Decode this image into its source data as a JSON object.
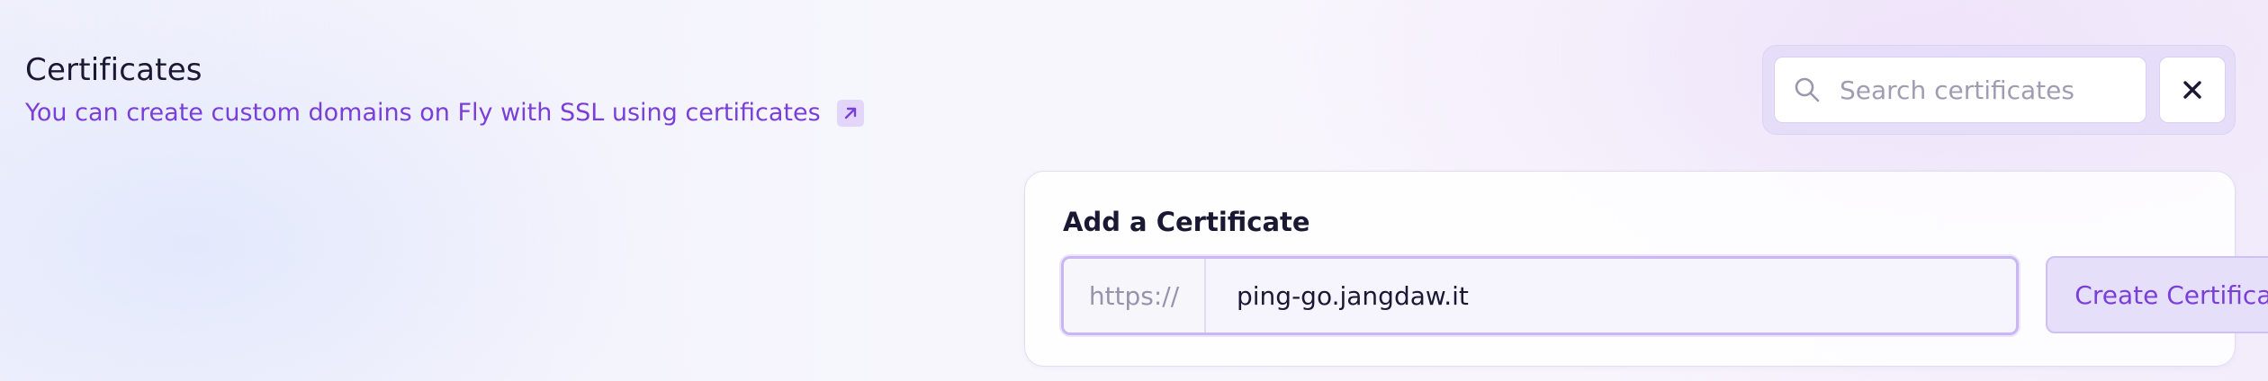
{
  "header": {
    "title": "Certificates",
    "subtitle_link": "You can create custom domains on Fly with SSL using certificates",
    "external_icon": "arrow-up-right-icon"
  },
  "search": {
    "placeholder": "Search certificates",
    "value": "",
    "icon": "search-icon",
    "close_icon": "close-icon"
  },
  "add_certificate": {
    "title": "Add a Certificate",
    "url_prefix": "https://",
    "hostname_value": "ping-go.jangdaw.it",
    "create_button_label": "Create Certificate"
  },
  "colors": {
    "accent": "#7a3fd9",
    "text": "#1a1833",
    "muted": "#9893ad",
    "accent_soft": "#e6dff9"
  }
}
